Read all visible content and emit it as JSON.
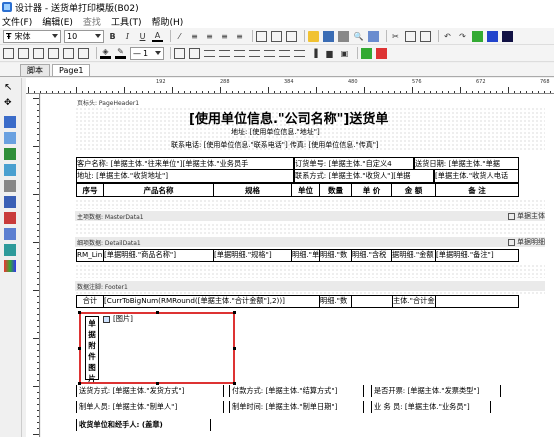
{
  "window": {
    "title": "设计器 - 送货单打印模版(B02)"
  },
  "menu": [
    "文件(F)",
    "编辑(E)",
    "查找",
    "工具(T)",
    "帮助(H)"
  ],
  "toolbar": {
    "font_name": "宋体",
    "font_size": "10",
    "line_width": "1"
  },
  "tabs": [
    "脚本",
    "Page1"
  ],
  "ruler": [
    "192",
    "288",
    "384",
    "480",
    "576",
    "672",
    "768"
  ],
  "report": {
    "bands": {
      "page_header": "页标头: PageHeader1",
      "master": "主项数据: MasterData1",
      "detail": "细项数据: DetailData1",
      "footer": "数据注脚: Footer1",
      "master_right": "单据主体",
      "detail_right": "单据明细"
    },
    "title": "[使用单位信息.\"公司名称\"]送货单",
    "address": "地址: [使用单位信息.\"地址\"]",
    "contact": "联系电话: [使用单位信息.\"联系电话\"] 传真: [使用单位信息.\"传真\"]",
    "customer": "客户名称: [单据主体.\"往来单位\"][单据主体.\"业务员手",
    "order_no": "订货单号: [单据主体.\"自定义4",
    "send_date": "送货日期: [单据主体.\"单据",
    "recv_addr": "地址: [单据主体.\"收货地址\"]",
    "contact_way": "联系方式: [单据主体.\"收货人\"][单据",
    "phone_tail": "[单据主体.\"收货人电话",
    "columns": [
      "序号",
      "产品名称",
      "规格",
      "单位",
      "数量",
      "单 价",
      "金 额",
      "备 注"
    ],
    "detail_cells": [
      "RM_Lin",
      "[单据明细.\"商品名称\"]",
      "[单据明细.\"规格\"]",
      "明细.\"单",
      "明细.\"数",
      "明细.\"含税",
      "据明细.\"金额",
      "[单据明细.\"备注\"]"
    ],
    "total_label": "合计",
    "total_formula": "[CurrToBigNum(RMRound([单据主体.\"合计金额\"],2))]",
    "total_num": "明细.\"数",
    "total_amount": "主体.\"合计金",
    "attach_label": [
      "单",
      "据",
      "附",
      "件",
      "图",
      "片"
    ],
    "picture": "[图片]",
    "footer_rows": [
      [
        "送货方式: [单据主体.\"发货方式\"]",
        "付款方式: [单据主体.\"结算方式\"]",
        "是否开票: [单据主体.\"发票类型\"]"
      ],
      [
        "制单人员: [单据主体.\"制单人\"]",
        "制单时间: [单据主体.\"制单日期\"]",
        "业 务 员: [单据主体.\"业务员\"]"
      ]
    ],
    "sign": "收货单位和经手人: (盖章)"
  }
}
